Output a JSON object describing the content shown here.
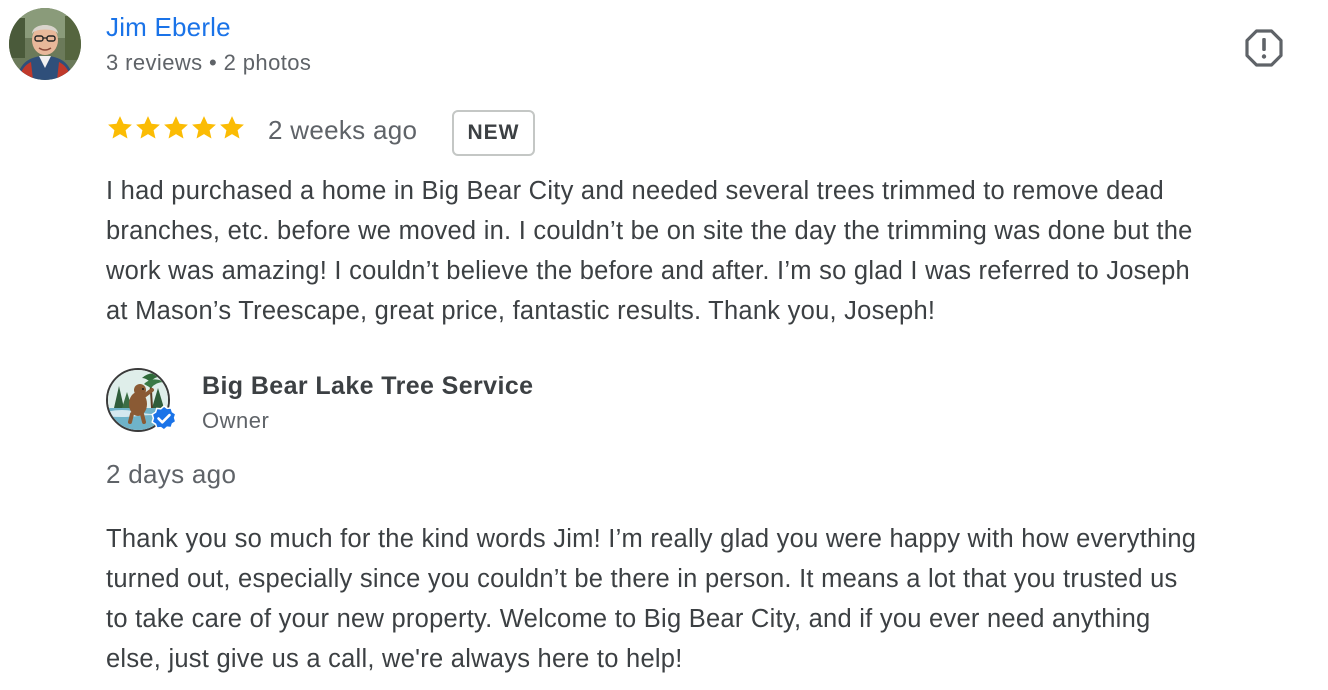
{
  "reviewer": {
    "name": "Jim Eberle",
    "meta": "3 reviews • 2 photos"
  },
  "review": {
    "rating": 5,
    "max_rating": 5,
    "date": "2 weeks ago",
    "badge": "NEW",
    "lines": [
      "I had purchased a home in Big Bear City and needed several trees trimmed to remove dead",
      "branches, etc. before we moved in. I couldn’t be on site the day the trimming was done but the",
      "work was amazing! I couldn’t believe the before and after. I’m so glad I was referred to Joseph",
      "at Mason’s Treescape, great price, fantastic results. Thank you, Joseph!"
    ]
  },
  "owner_reply": {
    "name": "Big Bear Lake Tree Service",
    "role": "Owner",
    "date": "2 days ago",
    "lines": [
      "Thank you so much for the kind words Jim! I’m really glad you were happy with how everything",
      "turned out, especially since you couldn’t be there in person. It means a lot that you trusted us",
      "to take care of your new property. Welcome to Big Bear City, and if you ever need anything",
      "else, just give us a call, we're always here to help!"
    ]
  },
  "icons": {
    "flag": "report-flag-icon",
    "star": "star-icon",
    "verified": "verified-check-icon"
  },
  "colors": {
    "link": "#1a73e8",
    "star": "#fbbc04",
    "text": "#3c4043",
    "muted": "#5f6368",
    "verified": "#1a73e8"
  }
}
